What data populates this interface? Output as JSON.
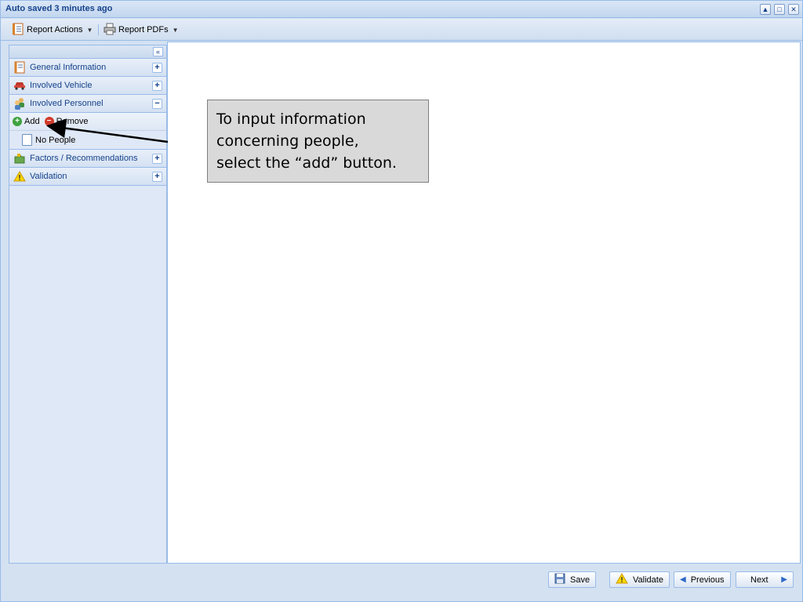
{
  "window": {
    "title": "Auto saved 3 minutes ago"
  },
  "toolbar": {
    "report_actions_label": "Report Actions",
    "report_pdfs_label": "Report PDFs"
  },
  "sidebar": {
    "collapse_glyph": "«",
    "items": [
      {
        "label": "General Information",
        "icon": "form-icon",
        "toggle": "+"
      },
      {
        "label": "Involved Vehicle",
        "icon": "car-icon",
        "toggle": "+"
      },
      {
        "label": "Involved Personnel",
        "icon": "people-icon",
        "toggle": "−"
      },
      {
        "label": "Factors / Recommendations",
        "icon": "puzzle-icon",
        "toggle": "+"
      },
      {
        "label": "Validation",
        "icon": "warning-icon",
        "toggle": "+"
      }
    ],
    "personnel": {
      "add_label": "Add",
      "remove_label": "Remove",
      "empty_label": "No People"
    }
  },
  "callout": {
    "line1": "To input information",
    "line2": "concerning people,",
    "line3": "select the “add” button."
  },
  "footer": {
    "save_label": "Save",
    "validate_label": "Validate",
    "previous_label": "Previous",
    "next_label": "Next"
  }
}
